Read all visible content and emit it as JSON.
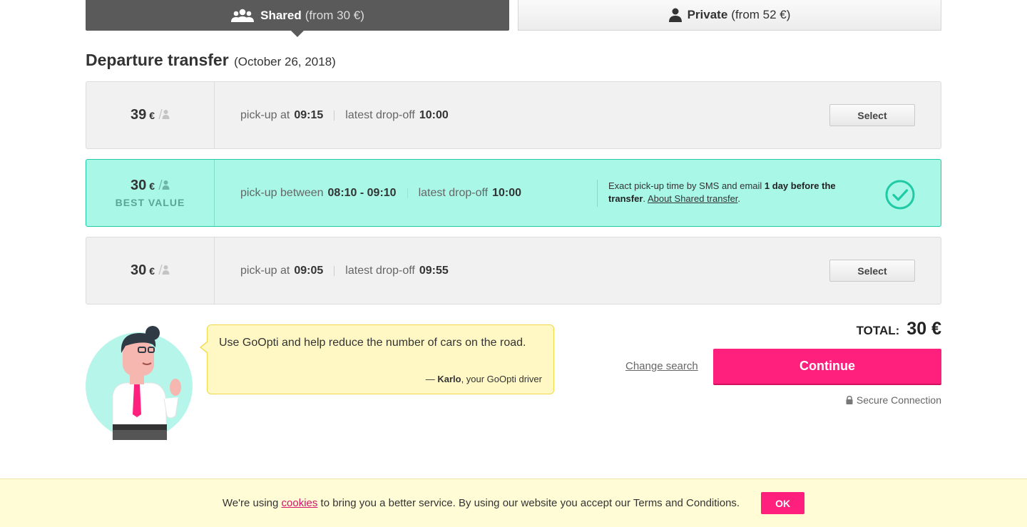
{
  "tabs": [
    {
      "name": "Shared",
      "from": "(from 30 €)",
      "icon": "group-icon",
      "active": true
    },
    {
      "name": "Private",
      "from": "(from 52 €)",
      "icon": "person-icon",
      "active": false
    }
  ],
  "section": {
    "title": "Departure transfer",
    "date": "(October 26, 2018)"
  },
  "options": [
    {
      "price": "39",
      "currency": "€",
      "pickup_label": "pick-up at",
      "pickup_time": "09:15",
      "dropoff_label": "latest drop-off",
      "dropoff_time": "10:00",
      "button": "Select"
    },
    {
      "price": "30",
      "currency": "€",
      "badge": "BEST VALUE",
      "pickup_label": "pick-up between",
      "pickup_time": "08:10 - 09:10",
      "dropoff_label": "latest drop-off",
      "dropoff_time": "10:00",
      "note_prefix": "Exact pick-up time by SMS and email ",
      "note_bold": "1 day before the transfer",
      "note_mid": ". ",
      "note_link": "About Shared transfer",
      "note_suffix": ".",
      "selected": true
    },
    {
      "price": "30",
      "currency": "€",
      "pickup_label": "pick-up at",
      "pickup_time": "09:05",
      "dropoff_label": "latest drop-off",
      "dropoff_time": "09:55",
      "button": "Select"
    }
  ],
  "driver": {
    "quote": "Use GoOpti and help reduce the number of cars on the road.",
    "sig_dash": "— ",
    "sig_name": "Karlo",
    "sig_role": ", your GoOpti driver"
  },
  "summary": {
    "total_label": "TOTAL:",
    "total_value": "30 €",
    "change_search": "Change search",
    "continue": "Continue",
    "secure": "Secure Connection"
  },
  "cookie": {
    "prefix": "We're using ",
    "link": "cookies",
    "suffix": " to bring you a better service. By using our website you accept our Terms and Conditions.",
    "ok": "OK"
  },
  "colors": {
    "accent_pink": "#ff1f7c",
    "best_value_bg": "#a8f7e7",
    "check_green": "#1fcaa5",
    "tab_active": "#5a5a5a"
  }
}
